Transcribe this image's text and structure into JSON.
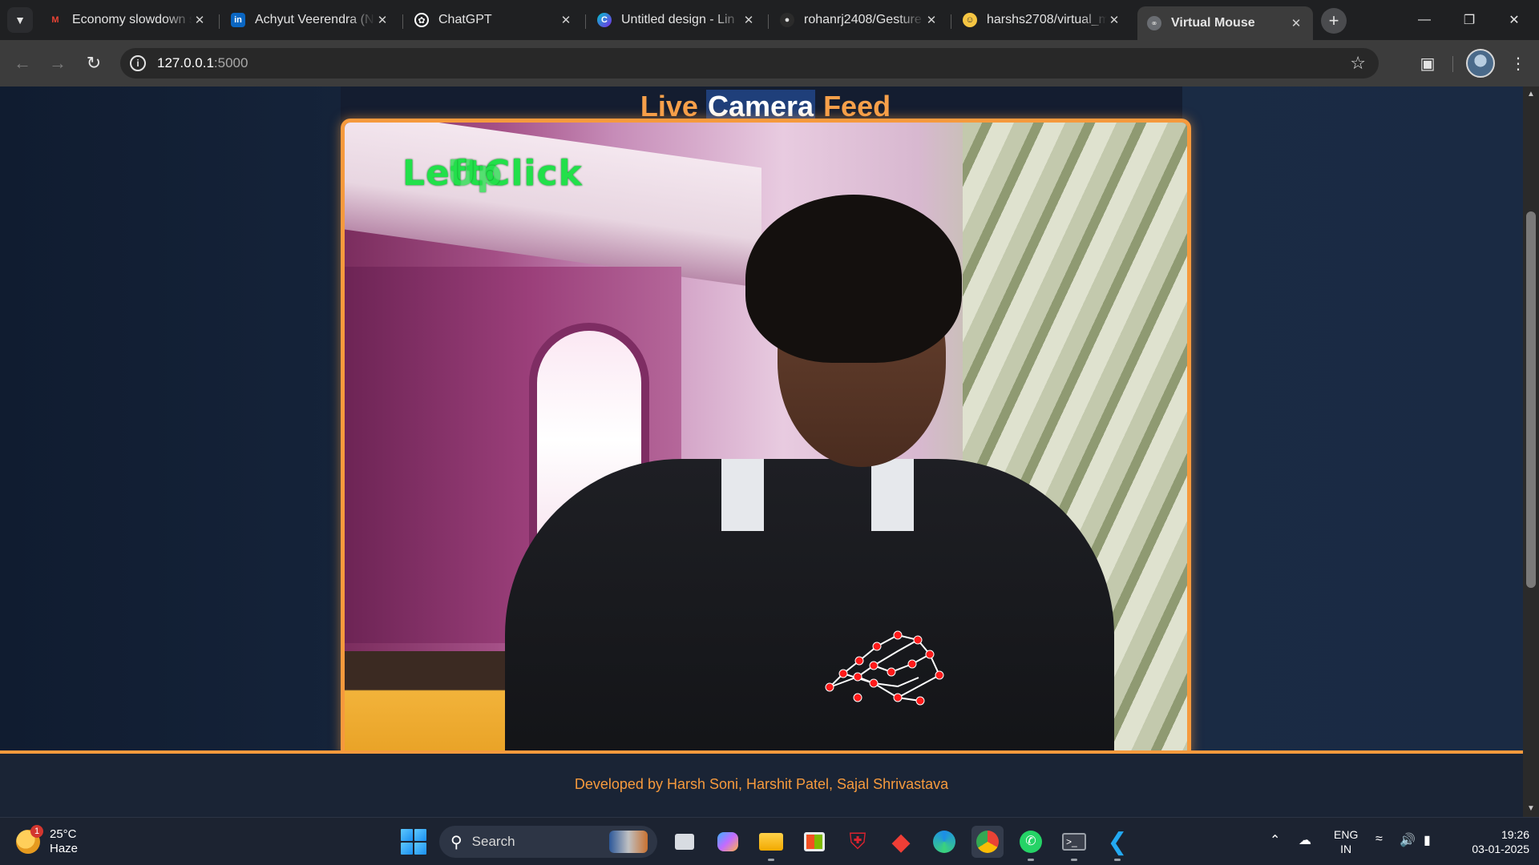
{
  "browser": {
    "tabs": [
      {
        "title": "Economy slowdown s",
        "favicon": "gmail-icon",
        "accent": "#ea4335"
      },
      {
        "title": "Achyut Veerendra (N",
        "favicon": "linkedin-icon",
        "accent": "#0a66c2"
      },
      {
        "title": "ChatGPT",
        "favicon": "chatgpt-icon",
        "accent": "#ffffff"
      },
      {
        "title": "Untitled design - Lin",
        "favicon": "canva-icon",
        "accent": "#00c4cc"
      },
      {
        "title": "rohanrj2408/Gesture",
        "favicon": "github-icon",
        "accent": "#ffffff"
      },
      {
        "title": "harshs2708/virtual_m",
        "favicon": "github-icon",
        "accent": "#f5c542"
      },
      {
        "title": "Virtual Mouse",
        "favicon": "globe-icon",
        "accent": "#9aa0a6",
        "active": true
      }
    ],
    "address": {
      "host": "127.0.0.1",
      "port": ":5000"
    }
  },
  "page": {
    "heading_live": "Live",
    "heading_camera": "Camera",
    "heading_feed": "Feed",
    "overlay_text_1": "LeftClick",
    "overlay_text_2": "Up",
    "footer": "Developed by Harsh Soni, Harshit Patel, Sajal Shrivastava",
    "accent_color": "#f69a3d"
  },
  "taskbar": {
    "weather_temp": "25°C",
    "weather_desc": "Haze",
    "weather_badge": "1",
    "search_label": "Search",
    "lang_1": "ENG",
    "lang_2": "IN",
    "time": "19:26",
    "date": "03-01-2025"
  }
}
